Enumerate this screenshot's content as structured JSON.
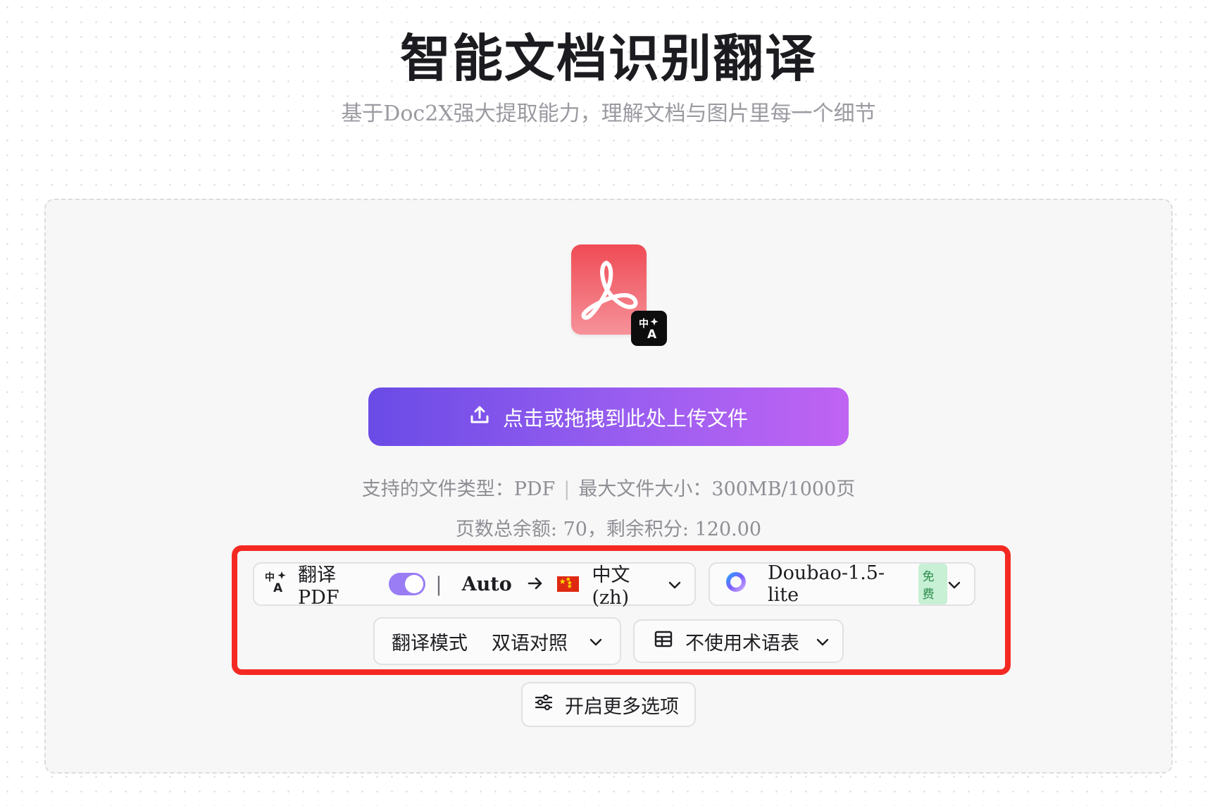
{
  "header": {
    "title": "智能文档识别翻译",
    "subtitle": "基于Doc2X强大提取能力，理解文档与图片里每一个细节"
  },
  "upload": {
    "button_label": "点击或拖拽到此处上传文件",
    "supported_types": "支持的文件类型：PDF",
    "max_size": "最大文件大小：300MB/1000页",
    "separator": "|",
    "quota": "页数总余额: 70，剩余积分: 120.00"
  },
  "options": {
    "translate_label": "翻译 PDF",
    "translate_enabled": true,
    "source_lang": "Auto",
    "target_lang": "中文 (zh)",
    "model_name": "Doubao-1.5-lite",
    "model_badge": "免费",
    "mode_label": "翻译模式",
    "mode_value": "双语对照",
    "glossary_label": "不使用术语表",
    "more_options_label": "开启更多选项"
  },
  "icons": {
    "pdf": "pdf-file-icon",
    "translate_badge": "translate-icon",
    "upload": "upload-icon",
    "arrow": "arrow-right-icon",
    "flag": "china-flag-icon",
    "model_logo": "doubao-logo-icon",
    "table": "table-icon",
    "sliders": "sliders-icon",
    "chevron": "chevron-down-icon"
  },
  "colors": {
    "accent_start": "#6a4be6",
    "accent_end": "#c063f3",
    "highlight_border": "#f42a22",
    "pdf_red": "#ef4b55"
  }
}
